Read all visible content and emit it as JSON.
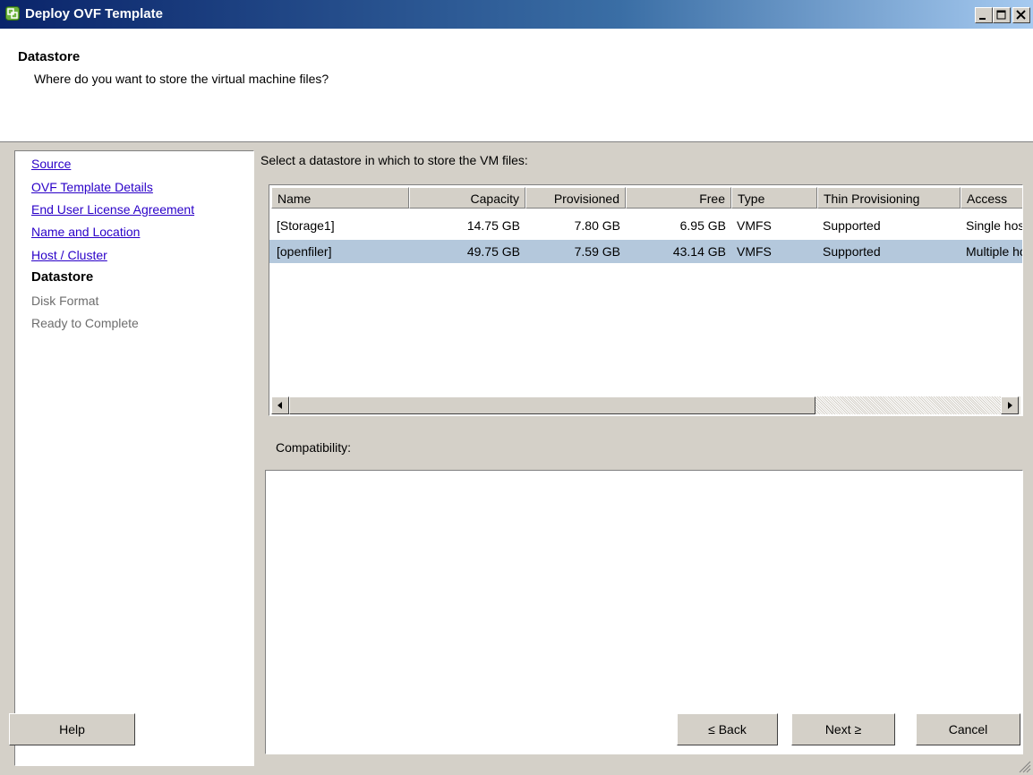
{
  "window": {
    "title": "Deploy OVF Template",
    "controls": [
      "minimize-icon",
      "maximize-icon",
      "close-icon"
    ]
  },
  "header": {
    "title": "Datastore",
    "subtitle": "Where do you want to store the virtual machine files?"
  },
  "steps": [
    {
      "label": "Source",
      "state": "link"
    },
    {
      "label": "OVF Template Details",
      "state": "link"
    },
    {
      "label": "End User License Agreement",
      "state": "link"
    },
    {
      "label": "Name and Location",
      "state": "link"
    },
    {
      "label": "Host / Cluster",
      "state": "link"
    },
    {
      "label": "Datastore",
      "state": "current"
    },
    {
      "label": "Disk Format",
      "state": "disabled"
    },
    {
      "label": "Ready to Complete",
      "state": "disabled"
    }
  ],
  "main": {
    "instruction": "Select a datastore in which to store the VM files:",
    "compatibility_label": "Compatibility:"
  },
  "table": {
    "columns": [
      "Name",
      "Capacity",
      "Provisioned",
      "Free",
      "Type",
      "Thin Provisioning",
      "Access"
    ],
    "rows": [
      {
        "name": "[Storage1]",
        "capacity": "14.75 GB",
        "provisioned": "7.80 GB",
        "free": "6.95 GB",
        "type": "VMFS",
        "thin": "Supported",
        "access": "Single host"
      },
      {
        "name": "[openfiler]",
        "capacity": "49.75 GB",
        "provisioned": "7.59 GB",
        "free": "43.14 GB",
        "type": "VMFS",
        "thin": "Supported",
        "access": "Multiple hosts",
        "selected": true
      }
    ]
  },
  "buttons": {
    "help": "Help",
    "back": "≤ Back",
    "next": "Next ≥",
    "cancel": "Cancel"
  },
  "colors": {
    "title_bar": "#0a246a",
    "selected_row": "#b4c8dc",
    "link": "#2a00c8",
    "disabled_text": "#6d6d6d"
  }
}
